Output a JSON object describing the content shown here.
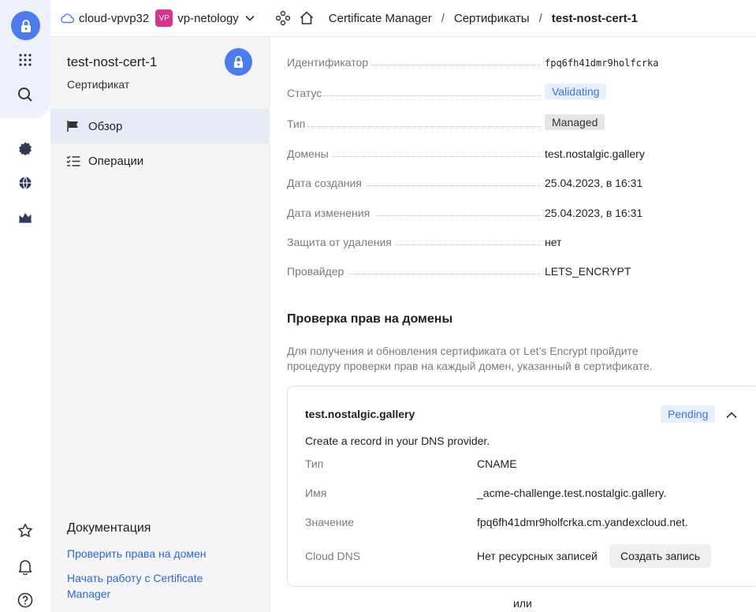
{
  "header": {
    "cloud_name": "cloud-vpvp32",
    "folder_badge": "VP",
    "folder_name": "vp-netology",
    "breadcrumbs": [
      "Certificate Manager",
      "Сертификаты",
      "test-nost-cert-1"
    ]
  },
  "sidebar": {
    "title": "test-nost-cert-1",
    "subtitle": "Сертификат",
    "nav": [
      {
        "label": "Обзор",
        "icon": "flag-icon",
        "active": true
      },
      {
        "label": "Операции",
        "icon": "list-check-icon",
        "active": false
      }
    ],
    "docs_title": "Документация",
    "docs_links": [
      "Проверить права на домен",
      "Начать работу с Certificate Manager"
    ]
  },
  "details": {
    "id": {
      "key": "Идентификатор",
      "value": "fpq6fh41dmr9holfcrka"
    },
    "status": {
      "key": "Статус",
      "value": "Validating"
    },
    "type": {
      "key": "Тип",
      "value": "Managed"
    },
    "domains": {
      "key": "Домены",
      "value": "test.nostalgic.gallery"
    },
    "created": {
      "key": "Дата создания",
      "value": "25.04.2023, в 16:31"
    },
    "updated": {
      "key": "Дата изменения",
      "value": "25.04.2023, в 16:31"
    },
    "protection": {
      "key": "Защита от удаления",
      "value": "нет"
    },
    "provider": {
      "key": "Провайдер",
      "value": "LETS_ENCRYPT"
    }
  },
  "validation": {
    "title": "Проверка прав на домены",
    "description": "Для получения и обновления сертификата от Let’s Encrypt пройдите процедуру проверки прав на каждый домен, указанный в сертификате.",
    "card": {
      "domain": "test.nostalgic.gallery",
      "status": "Pending",
      "intro": "Create a record in your DNS provider.",
      "type_key": "Тип",
      "type_value": "CNAME",
      "name_key": "Имя",
      "name_value": "_acme-challenge.test.nostalgic.gallery.",
      "value_key": "Значение",
      "value_value": "fpq6fh41dmr9holfcrka.cm.yandexcloud.net.",
      "dns_key": "Cloud DNS",
      "dns_value": "Нет ресурсных записей",
      "create_button": "Создать запись"
    },
    "or_label": "или"
  },
  "colors": {
    "accent": "#4b7bec",
    "link": "#2b66d6",
    "pending_bg": "#e6effd",
    "folder_badge": "#d9338f"
  }
}
